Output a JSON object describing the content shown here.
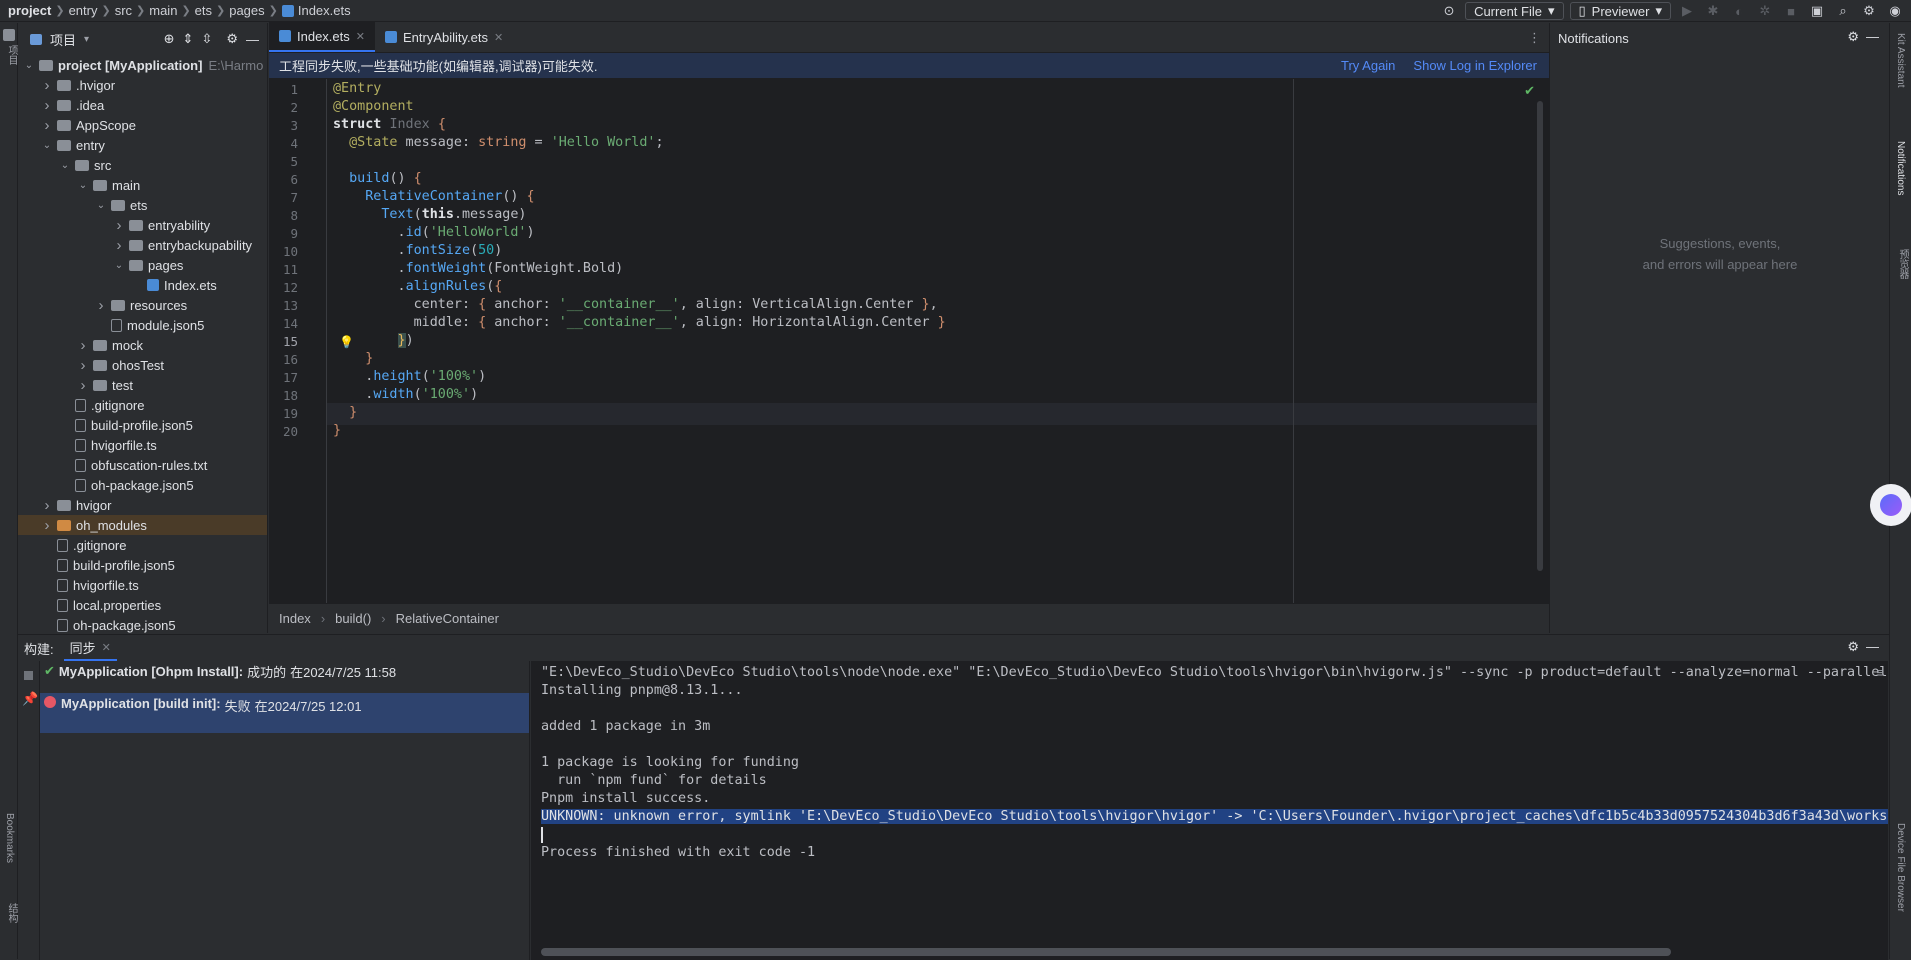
{
  "breadcrumb": {
    "items": [
      "project",
      "entry",
      "src",
      "main",
      "ets",
      "pages",
      "Index.ets"
    ]
  },
  "toolbar": {
    "current_file": "Current File",
    "previewer": "Previewer"
  },
  "left_strip": {
    "top_label": "项目",
    "bookmarks": "Bookmarks",
    "structure": "结构"
  },
  "right_strip": {
    "kit_assistant": "Kit Assistant",
    "notifications": "Notifications",
    "previewer": "预览器",
    "device_file_browser": "Device File Browser"
  },
  "project_panel": {
    "title": "项目",
    "tree": [
      {
        "label": "project [MyApplication]",
        "extra": "E:\\Harmo",
        "depth": 0,
        "chevron": "down",
        "icon": "folder"
      },
      {
        "label": ".hvigor",
        "depth": 1,
        "chevron": "right",
        "icon": "folder"
      },
      {
        "label": ".idea",
        "depth": 1,
        "chevron": "right",
        "icon": "folder"
      },
      {
        "label": "AppScope",
        "depth": 1,
        "chevron": "right",
        "icon": "folder"
      },
      {
        "label": "entry",
        "depth": 1,
        "chevron": "down",
        "icon": "folder"
      },
      {
        "label": "src",
        "depth": 2,
        "chevron": "down",
        "icon": "folder"
      },
      {
        "label": "main",
        "depth": 3,
        "chevron": "down",
        "icon": "folder"
      },
      {
        "label": "ets",
        "depth": 4,
        "chevron": "down",
        "icon": "folder"
      },
      {
        "label": "entryability",
        "depth": 5,
        "chevron": "right",
        "icon": "folder"
      },
      {
        "label": "entrybackupability",
        "depth": 5,
        "chevron": "right",
        "icon": "folder"
      },
      {
        "label": "pages",
        "depth": 5,
        "chevron": "down",
        "icon": "folder"
      },
      {
        "label": "Index.ets",
        "depth": 6,
        "chevron": "",
        "icon": "ets"
      },
      {
        "label": "resources",
        "depth": 4,
        "chevron": "right",
        "icon": "folder"
      },
      {
        "label": "module.json5",
        "depth": 4,
        "chevron": "",
        "icon": "file"
      },
      {
        "label": "mock",
        "depth": 3,
        "chevron": "right",
        "icon": "folder"
      },
      {
        "label": "ohosTest",
        "depth": 3,
        "chevron": "right",
        "icon": "folder"
      },
      {
        "label": "test",
        "depth": 3,
        "chevron": "right",
        "icon": "folder"
      },
      {
        "label": ".gitignore",
        "depth": 2,
        "chevron": "",
        "icon": "file"
      },
      {
        "label": "build-profile.json5",
        "depth": 2,
        "chevron": "",
        "icon": "file"
      },
      {
        "label": "hvigorfile.ts",
        "depth": 2,
        "chevron": "",
        "icon": "file"
      },
      {
        "label": "obfuscation-rules.txt",
        "depth": 2,
        "chevron": "",
        "icon": "file"
      },
      {
        "label": "oh-package.json5",
        "depth": 2,
        "chevron": "",
        "icon": "file"
      },
      {
        "label": "hvigor",
        "depth": 1,
        "chevron": "right",
        "icon": "folder"
      },
      {
        "label": "oh_modules",
        "depth": 1,
        "chevron": "right",
        "icon": "folder-orange",
        "highlight": true
      },
      {
        "label": ".gitignore",
        "depth": 1,
        "chevron": "",
        "icon": "file"
      },
      {
        "label": "build-profile.json5",
        "depth": 1,
        "chevron": "",
        "icon": "file"
      },
      {
        "label": "hvigorfile.ts",
        "depth": 1,
        "chevron": "",
        "icon": "file"
      },
      {
        "label": "local.properties",
        "depth": 1,
        "chevron": "",
        "icon": "file"
      },
      {
        "label": "oh-package.json5",
        "depth": 1,
        "chevron": "",
        "icon": "file"
      }
    ]
  },
  "editor": {
    "tabs": [
      {
        "label": "Index.ets",
        "active": true
      },
      {
        "label": "EntryAbility.ets",
        "active": false
      }
    ],
    "banner": {
      "message": "工程同步失败,一些基础功能(如编辑器,调试器)可能失效.",
      "try_again": "Try Again",
      "show_log": "Show Log in Explorer"
    },
    "current_line": 15,
    "lines": [
      "1",
      "2",
      "3",
      "4",
      "5",
      "6",
      "7",
      "8",
      "9",
      "10",
      "11",
      "12",
      "13",
      "14",
      "15",
      "16",
      "17",
      "18",
      "19",
      "20"
    ],
    "statusbar": [
      "Index",
      "build()",
      "RelativeContainer"
    ]
  },
  "notifications": {
    "title": "Notifications",
    "empty_line1": "Suggestions, events,",
    "empty_line2": "and errors will appear here"
  },
  "build_panel": {
    "label": "构建:",
    "tab": "同步",
    "items": [
      {
        "name": "MyApplication [Ohpm Install]:",
        "status": "成功的",
        "time": "在2024/7/25 11:58",
        "ok": true
      },
      {
        "name": "MyApplication [build init]:",
        "status": "失败",
        "time": "在2024/7/25 12:01",
        "ok": false
      }
    ],
    "console": [
      "\"E:\\DevEco_Studio\\DevEco Studio\\tools\\node\\node.exe\" \"E:\\DevEco_Studio\\DevEco Studio\\tools\\hvigor\\bin\\hvigorw.js\" --sync -p product=default --analyze=normal --parallel",
      "Installing pnpm@8.13.1...",
      "",
      "added 1 package in 3m",
      "",
      "1 package is looking for funding",
      "  run `npm fund` for details",
      "Pnpm install success.",
      "UNKNOWN: unknown error, symlink 'E:\\DevEco_Studio\\DevEco Studio\\tools\\hvigor\\hvigor' -> 'C:\\Users\\Founder\\.hvigor\\project_caches\\dfc1b5c4b33d0957524304b3d6f3a43d\\worksp",
      "",
      "Process finished with exit code -1"
    ],
    "highlight_line": 8
  },
  "colors": {
    "accent": "#3574f0",
    "error": "#e55765",
    "success": "#5fb865",
    "banner": "#25324d"
  }
}
